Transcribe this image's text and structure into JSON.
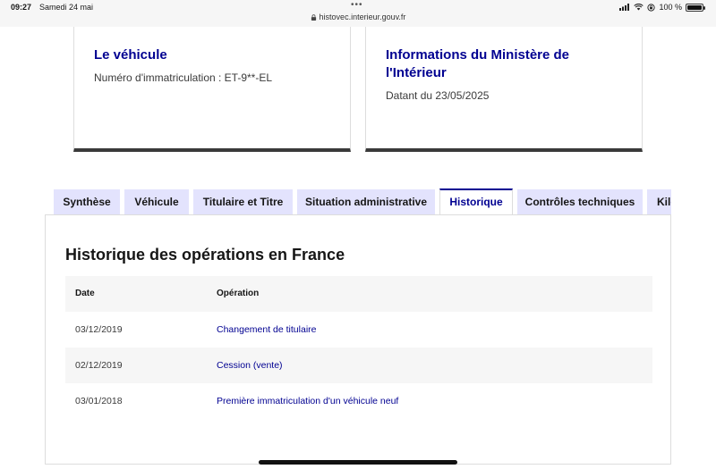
{
  "status_bar": {
    "time": "09:27",
    "date": "Samedi 24 mai",
    "url": "histovec.interieur.gouv.fr",
    "battery": "100 %"
  },
  "vehicle_card": {
    "title": "Le véhicule",
    "registration": "Numéro d'immatriculation : ET-9**-EL"
  },
  "ministry_card": {
    "title": "Informations du Ministère de l'Intérieur",
    "date": "Datant du 23/05/2025"
  },
  "tabs": [
    {
      "label": "Synthèse"
    },
    {
      "label": "Véhicule"
    },
    {
      "label": "Titulaire et Titre"
    },
    {
      "label": "Situation administrative"
    },
    {
      "label": "Historique"
    },
    {
      "label": "Contrôles techniques"
    },
    {
      "label": "Kilométrage"
    }
  ],
  "active_tab": "Historique",
  "history": {
    "title": "Historique des opérations en France",
    "columns": {
      "date": "Date",
      "operation": "Opération"
    },
    "rows": [
      {
        "date": "03/12/2019",
        "operation": "Changement de titulaire"
      },
      {
        "date": "02/12/2019",
        "operation": "Cession (vente)"
      },
      {
        "date": "03/01/2018",
        "operation": "Première immatriculation d'un véhicule neuf"
      }
    ]
  },
  "colors": {
    "primary": "#000091",
    "tab_background": "#e3e3fd",
    "row_alt": "#f6f6f6",
    "card_border": "#3a3a3a"
  }
}
